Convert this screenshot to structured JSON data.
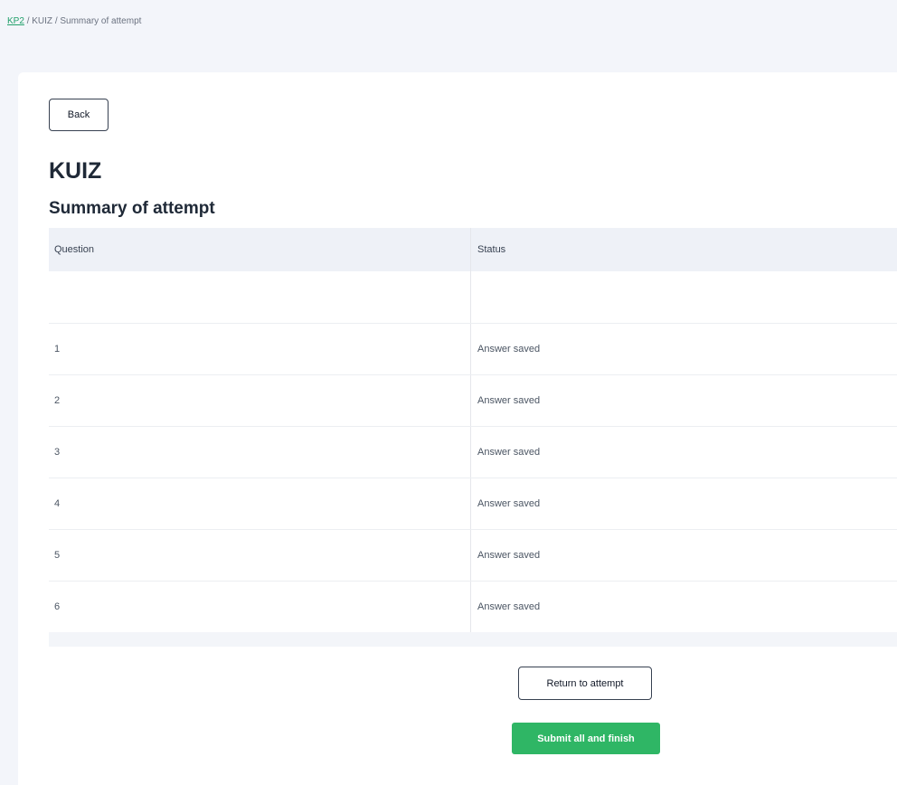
{
  "breadcrumb": {
    "items": [
      {
        "label": "KP2",
        "link": true
      },
      {
        "label": "KUIZ",
        "link": false
      },
      {
        "label": "Summary of attempt",
        "link": false
      }
    ],
    "separator": "/"
  },
  "back_button": "Back",
  "quiz_title": "KUIZ",
  "page_subtitle": "Summary of attempt",
  "table": {
    "headers": [
      "Question",
      "Status"
    ],
    "rows": [
      {
        "question": "1",
        "status": "Answer saved"
      },
      {
        "question": "2",
        "status": "Answer saved"
      },
      {
        "question": "3",
        "status": "Answer saved"
      },
      {
        "question": "4",
        "status": "Answer saved"
      },
      {
        "question": "5",
        "status": "Answer saved"
      },
      {
        "question": "6",
        "status": "Answer saved"
      }
    ]
  },
  "return_button": "Return to attempt",
  "submit_button": "Submit all and finish",
  "colors": {
    "accent_green": "#2fb665",
    "link_green": "#22a06b",
    "header_bg": "#eef1f7",
    "page_bg": "#f3f5fa"
  }
}
